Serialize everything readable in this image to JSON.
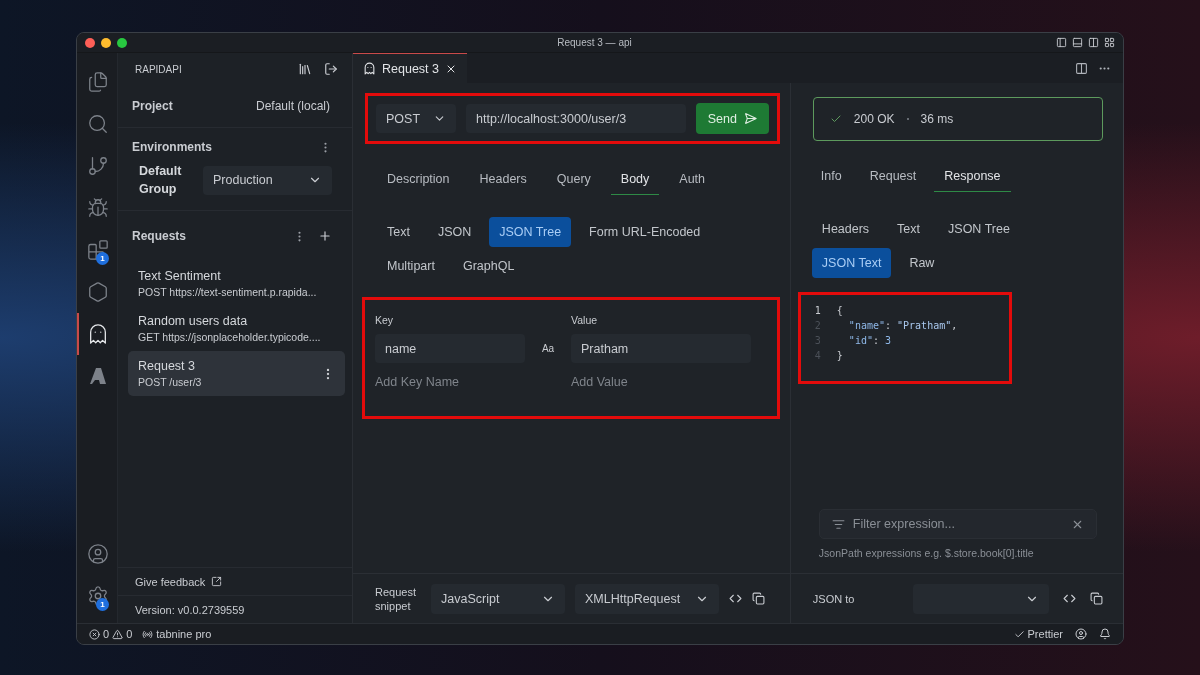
{
  "window": {
    "title": "Request 3 — api"
  },
  "activity_bar": {
    "top": [
      {
        "selected": false
      },
      {
        "selected": false
      },
      {
        "selected": false
      },
      {
        "selected": false
      },
      {
        "selected": false,
        "badge": "1"
      },
      {
        "selected": false
      },
      {
        "selected": true
      },
      {
        "selected": false
      }
    ],
    "bottom": [
      {
        "selected": false
      },
      {
        "selected": false,
        "badge": "1"
      }
    ]
  },
  "sidebar": {
    "title": "RAPIDAPI",
    "project": {
      "label": "Project",
      "value": "Default (local)"
    },
    "environments": {
      "title": "Environments",
      "group_label": "Default Group",
      "selected_env": "Production"
    },
    "requests": {
      "title": "Requests",
      "items": [
        {
          "name": "Text Sentiment",
          "detail": "POST https://text-sentiment.p.rapida...",
          "selected": false
        },
        {
          "name": "Random users data",
          "detail": "GET https://jsonplaceholder.typicode....",
          "selected": false
        },
        {
          "name": "Request 3",
          "detail": "POST /user/3",
          "selected": true
        }
      ]
    },
    "feedback": "Give feedback",
    "version": "Version: v0.0.2739559"
  },
  "editor_tabs": [
    {
      "label": "Request 3",
      "selected": true
    }
  ],
  "request": {
    "method": "POST",
    "url": "http://localhost:3000/user/3",
    "send": "Send",
    "tabs": [
      {
        "label": "Description",
        "selected": false
      },
      {
        "label": "Headers",
        "selected": false
      },
      {
        "label": "Query",
        "selected": false
      },
      {
        "label": "Body",
        "selected": true
      },
      {
        "label": "Auth",
        "selected": false
      }
    ],
    "body_types": [
      {
        "label": "Text",
        "selected": false
      },
      {
        "label": "JSON",
        "selected": false
      },
      {
        "label": "JSON Tree",
        "selected": true
      },
      {
        "label": "Form URL-Encoded",
        "selected": false
      },
      {
        "label": "Multipart",
        "selected": false
      },
      {
        "label": "GraphQL",
        "selected": false
      }
    ],
    "tree": {
      "key_header": "Key",
      "value_header": "Value",
      "rows": [
        {
          "key": "name",
          "type": "Aa",
          "value": "Pratham"
        }
      ],
      "key_placeholder": "Add Key Name",
      "value_placeholder": "Add Value"
    },
    "snippet": {
      "label": "Request snippet",
      "language": "JavaScript",
      "library": "XMLHttpRequest"
    }
  },
  "response": {
    "status": "200 OK",
    "time": "36 ms",
    "tabs": [
      {
        "label": "Info",
        "selected": false
      },
      {
        "label": "Request",
        "selected": false
      },
      {
        "label": "Response",
        "selected": true
      }
    ],
    "views": [
      {
        "label": "Headers",
        "selected": false
      },
      {
        "label": "Text",
        "selected": false
      },
      {
        "label": "JSON Tree",
        "selected": false
      },
      {
        "label": "JSON Text",
        "selected": true
      },
      {
        "label": "Raw",
        "selected": false
      }
    ],
    "code": [
      {
        "number": "1",
        "active": true,
        "kind": "brace",
        "tokens": [
          {
            "kind": "punct",
            "text": "{"
          }
        ]
      },
      {
        "number": "2",
        "active": false,
        "kind": "member",
        "tokens": [
          {
            "kind": "key",
            "text": "\"name\""
          },
          {
            "kind": "punct",
            "text": ": "
          },
          {
            "kind": "string",
            "text": "\"Pratham\""
          },
          {
            "kind": "punct",
            "text": ","
          }
        ]
      },
      {
        "number": "3",
        "active": false,
        "kind": "member",
        "tokens": [
          {
            "kind": "key",
            "text": "\"id\""
          },
          {
            "kind": "punct",
            "text": ": "
          },
          {
            "kind": "number",
            "text": "3"
          }
        ]
      },
      {
        "number": "4",
        "active": false,
        "kind": "brace",
        "tokens": [
          {
            "kind": "punct",
            "text": "}"
          }
        ]
      }
    ],
    "filter": {
      "placeholder": "Filter expression...",
      "hint": "JsonPath expressions e.g. $.store.book[0].title"
    },
    "convert_label": "JSON to"
  },
  "status_bar": {
    "errors": "0",
    "warnings": "0",
    "tabnine": "tabnine pro",
    "prettier": "Prettier"
  }
}
